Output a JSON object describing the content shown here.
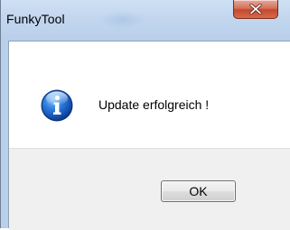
{
  "window": {
    "title": "FunkyTool",
    "close_icon": "close-icon",
    "close_color": "#c24a2e"
  },
  "dialog": {
    "icon": "info-icon",
    "icon_color": "#1f6fd1",
    "message": "Update erfolgreich !",
    "ok_label": "OK"
  }
}
